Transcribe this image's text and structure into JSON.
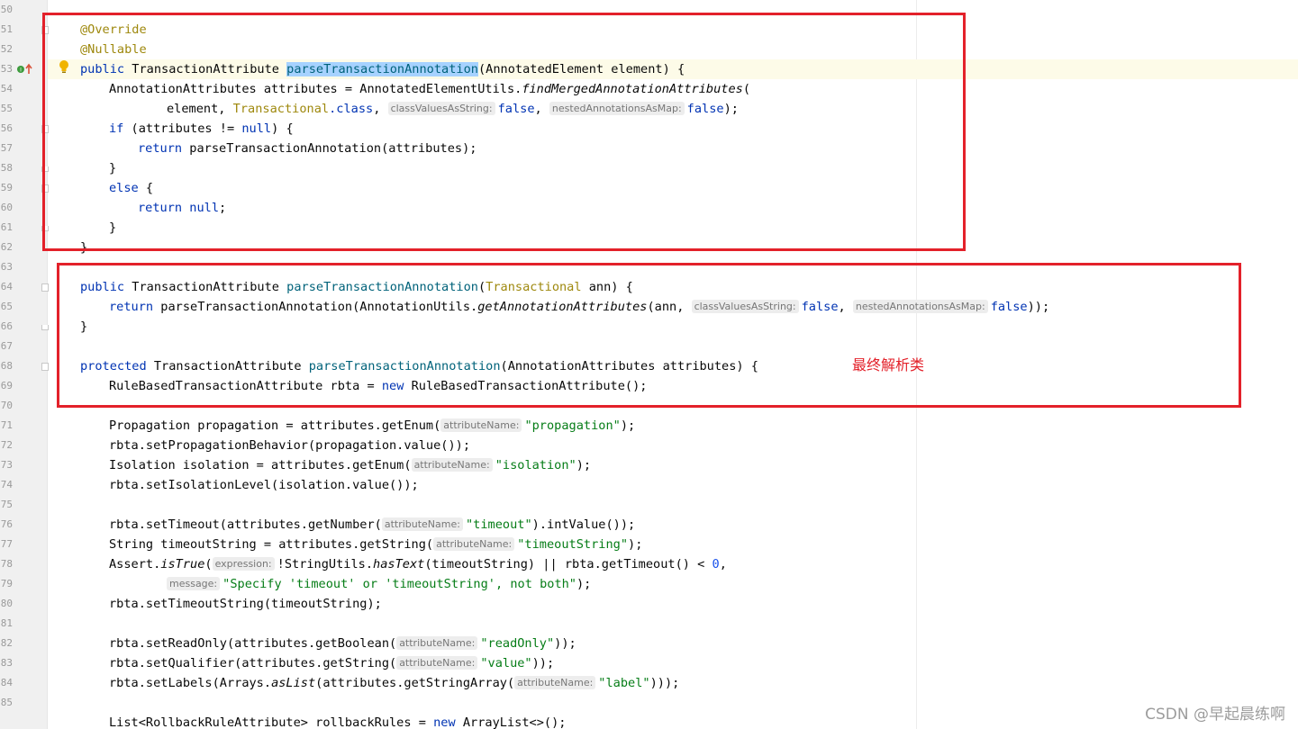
{
  "line_numbers": [
    "50",
    "51",
    "52",
    "53",
    "54",
    "55",
    "56",
    "57",
    "58",
    "59",
    "60",
    "61",
    "62",
    "63",
    "64",
    "65",
    "66",
    "67",
    "68",
    "69",
    "70",
    "71",
    "72",
    "73",
    "74",
    "75",
    "76",
    "77",
    "78",
    "79",
    "80",
    "81",
    "82",
    "83",
    "84",
    "85"
  ],
  "code": {
    "l51": "@Override",
    "l52": "@Nullable",
    "l53_kw": "public",
    "l53_type": " TransactionAttribute ",
    "l53_sel": "parseTransactionAnnotation",
    "l53_rest": "(AnnotatedElement element) {",
    "l54_a": "AnnotationAttributes attributes = AnnotatedElementUtils.",
    "l54_m": "findMergedAnnotationAttributes",
    "l54_b": "(",
    "l55_a": "element, ",
    "l55_ann": "Transactional",
    "l55_kw1": ".class",
    "l55_b": ", ",
    "l55_h1": "classValuesAsString:",
    "l55_v1": "false",
    "l55_c": ", ",
    "l55_h2": "nestedAnnotationsAsMap:",
    "l55_v2": "false",
    "l55_d": ");",
    "l56_kw": "if",
    "l56_a": " (attributes != ",
    "l56_null": "null",
    "l56_b": ") {",
    "l57_kw": "return",
    "l57_a": " parseTransactionAnnotation(attributes);",
    "l58": "}",
    "l59_kw": "else",
    "l59_a": " {",
    "l60_kw": "return",
    "l60_null": " null",
    "l60_a": ";",
    "l61": "}",
    "l62": "}",
    "l64_kw": "public",
    "l64_a": " TransactionAttribute ",
    "l64_m": "parseTransactionAnnotation",
    "l64_b": "(",
    "l64_ann": "Transactional",
    "l64_c": " ann) {",
    "l65_kw": "return",
    "l65_a": " parseTransactionAnnotation(AnnotationUtils.",
    "l65_m": "getAnnotationAttributes",
    "l65_b": "(ann, ",
    "l65_h1": "classValuesAsString:",
    "l65_v1": "false",
    "l65_c": ", ",
    "l65_h2": "nestedAnnotationsAsMap:",
    "l65_v2": "false",
    "l65_d": "));",
    "l66": "}",
    "l68_kw": "protected",
    "l68_a": " TransactionAttribute ",
    "l68_m": "parseTransactionAnnotation",
    "l68_b": "(AnnotationAttributes attributes) {",
    "l69_a": "RuleBasedTransactionAttribute rbta = ",
    "l69_kw": "new",
    "l69_b": " RuleBasedTransactionAttribute();",
    "l71_a": "Propagation propagation = attributes.getEnum(",
    "l71_h": "attributeName:",
    "l71_s": "\"propagation\"",
    "l71_b": ");",
    "l72": "rbta.setPropagationBehavior(propagation.value());",
    "l73_a": "Isolation isolation = attributes.getEnum(",
    "l73_h": "attributeName:",
    "l73_s": "\"isolation\"",
    "l73_b": ");",
    "l74": "rbta.setIsolationLevel(isolation.value());",
    "l76_a": "rbta.setTimeout(attributes.getNumber(",
    "l76_h": "attributeName:",
    "l76_s": "\"timeout\"",
    "l76_b": ").intValue());",
    "l77_a": "String timeoutString = attributes.getString(",
    "l77_h": "attributeName:",
    "l77_s": "\"timeoutString\"",
    "l77_b": ");",
    "l78_a": "Assert.",
    "l78_m": "isTrue",
    "l78_b": "(",
    "l78_h": "expression:",
    "l78_c": "!StringUtils.",
    "l78_m2": "hasText",
    "l78_d": "(timeoutString) || rbta.getTimeout() < ",
    "l78_n": "0",
    "l78_e": ",",
    "l79_h": "message:",
    "l79_s": "\"Specify 'timeout' or 'timeoutString', not both\"",
    "l79_b": ");",
    "l80": "rbta.setTimeoutString(timeoutString);",
    "l82_a": "rbta.setReadOnly(attributes.getBoolean(",
    "l82_h": "attributeName:",
    "l82_s": "\"readOnly\"",
    "l82_b": "));",
    "l83_a": "rbta.setQualifier(attributes.getString(",
    "l83_h": "attributeName:",
    "l83_s": "\"value\"",
    "l83_b": "));",
    "l84_a": "rbta.setLabels(Arrays.",
    "l84_m": "asList",
    "l84_b": "(attributes.getStringArray(",
    "l84_h": "attributeName:",
    "l84_s": "\"label\"",
    "l84_c": ")));",
    "l86_a": "List<RollbackRuleAttribute> rollbackRules = ",
    "l86_kw": "new",
    "l86_b": " ArrayList<>();"
  },
  "annotation_note": "最终解析类",
  "watermark": "CSDN @早起晨练啊",
  "colors": {
    "keyword": "#0033b3",
    "annotation": "#9e880d",
    "method": "#00627a",
    "string": "#067d17",
    "number": "#1750eb",
    "highlight_box": "#e3212a",
    "selection": "#a6d2ff"
  },
  "icons": [
    "implementation-marker-icon",
    "intention-bulb-icon"
  ]
}
